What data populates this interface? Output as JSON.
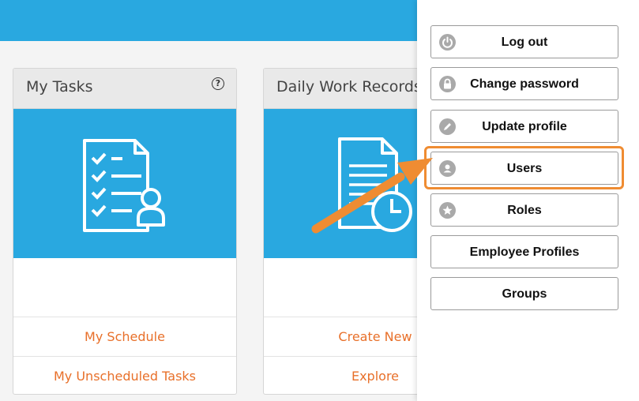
{
  "cards": [
    {
      "title": "My Tasks",
      "links": [
        "My Schedule",
        "My Unscheduled Tasks"
      ]
    },
    {
      "title": "Daily Work Records",
      "links": [
        "Create New",
        "Explore"
      ]
    }
  ],
  "menu": {
    "items": [
      {
        "label": "Log out",
        "icon": "power-icon"
      },
      {
        "label": "Change password",
        "icon": "lock-icon"
      },
      {
        "label": "Update profile",
        "icon": "pencil-icon"
      },
      {
        "label": "Users",
        "icon": "user-icon"
      },
      {
        "label": "Roles",
        "icon": "star-icon"
      },
      {
        "label": "Employee Profiles",
        "icon": ""
      },
      {
        "label": "Groups",
        "icon": ""
      }
    ]
  },
  "colors": {
    "header": "#29a8e0",
    "link": "#e8702a",
    "callout": "#ef8c32"
  }
}
